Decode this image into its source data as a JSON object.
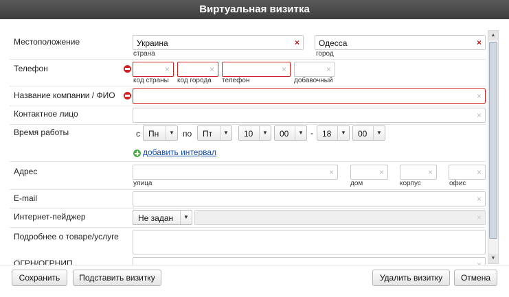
{
  "window": {
    "title": "Виртуальная визитка"
  },
  "location": {
    "label": "Местоположение",
    "country_value": "Украина",
    "country_hint": "страна",
    "city_value": "Одесса",
    "city_hint": "город"
  },
  "phone": {
    "label": "Телефон",
    "country_code_hint": "код страны",
    "city_code_hint": "код города",
    "number_hint": "телефон",
    "extension_hint": "добавочный"
  },
  "company": {
    "label": "Название компании / ФИО"
  },
  "contact": {
    "label": "Контактное лицо"
  },
  "hours": {
    "label": "Время работы",
    "from_label": "с",
    "from_day": "Пн",
    "to_label": "по",
    "to_day": "Пт",
    "from_hour": "10",
    "from_minute": "00",
    "dash": "-",
    "to_hour": "18",
    "to_minute": "00",
    "add_interval": "добавить интервал"
  },
  "address": {
    "label": "Адрес",
    "street_hint": "улица",
    "house_hint": "дом",
    "building_hint": "корпус",
    "office_hint": "офис"
  },
  "email": {
    "label": "E-mail"
  },
  "messenger": {
    "label": "Интернет-пейджер",
    "selected": "Не задан"
  },
  "details": {
    "label": "Подробнее о товаре/услуге"
  },
  "ogrn": {
    "label": "ОГРН/ОГРНИП"
  },
  "icons": {
    "clear": "×",
    "dropdown": "▼",
    "scroll_up": "▲",
    "scroll_down": "▼"
  },
  "footer": {
    "save": "Сохранить",
    "substitute": "Подставить визитку",
    "delete": "Удалить визитку",
    "cancel": "Отмена"
  },
  "colors": {
    "title_bg": "#4a4a4a",
    "error": "#d42020",
    "link": "#1a4fa8",
    "add": "#4ab043"
  }
}
